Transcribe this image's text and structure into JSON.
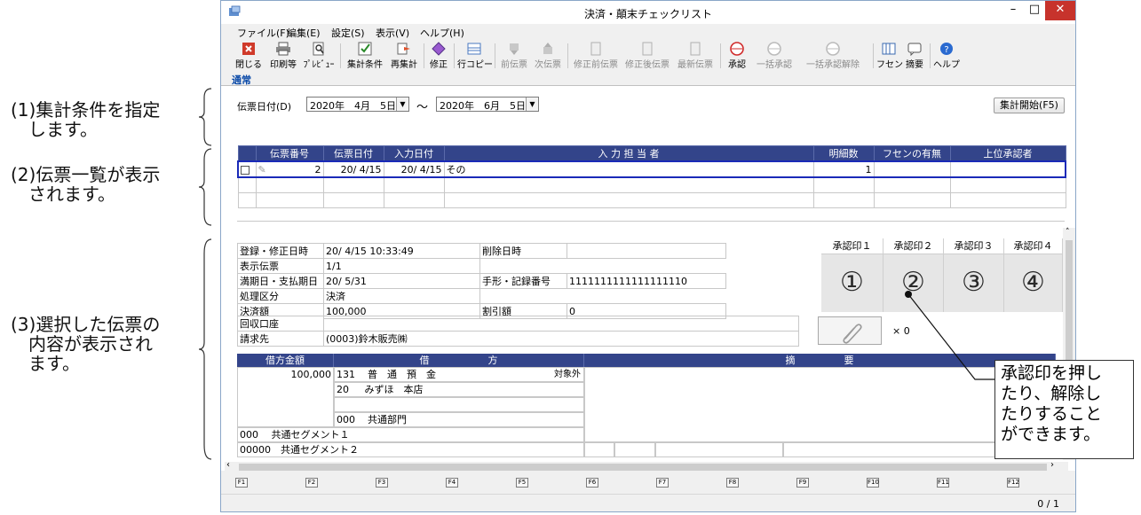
{
  "annotations": {
    "note1": "(1)集計条件を指定\n　します。",
    "note2": "(2)伝票一覧が表示\n　されます。",
    "note3": "(3)選択した伝票の\n　内容が表示され\n　ます。",
    "callout": "承認印を押し\nたり、解除し\nたりすること\nができます。"
  },
  "window": {
    "title": "決済・顛末チェックリスト",
    "minimize": "–",
    "maximize": "□",
    "close": "✕"
  },
  "menu": [
    "ファイル(F)",
    "編集(E)",
    "設定(S)",
    "表示(V)",
    "ヘルプ(H)"
  ],
  "toolbar": {
    "close": "閉じる",
    "print": "印刷等",
    "preview": "ﾌﾟﾚﾋﾞｭｰ",
    "conditions": "集計条件",
    "recalc": "再集計",
    "edit": "修正",
    "rowcopy": "行コピー",
    "prev": "前伝票",
    "next": "次伝票",
    "before_edit": "修正前伝票",
    "after_edit": "修正後伝票",
    "latest": "最新伝票",
    "approve": "承認",
    "bulk_approve": "一括承認",
    "bulk_release": "一括承認解除",
    "fusen": "フセン",
    "summary": "摘要",
    "help": "ヘルプ"
  },
  "tab": "通常",
  "filter": {
    "label": "伝票日付(D)",
    "from": "2020年　4月　5日",
    "tilde": "～",
    "to": "2020年　6月　5日",
    "start_button": "集計開始(F5)"
  },
  "list": {
    "headers": [
      "伝票番号",
      "伝票日付",
      "入力日付",
      "入 力 担 当 者",
      "明細数",
      "フセンの有無",
      "上位承認者"
    ],
    "rows": [
      {
        "no": "2",
        "date": "20/ 4/15",
        "input_date": "20/ 4/15",
        "staff": "その",
        "count": "1",
        "fusen": "",
        "approver": ""
      }
    ]
  },
  "detail": {
    "reg_label": "登録・修正日時",
    "reg_value": "20/ 4/15 10:33:49",
    "del_label": "削除日時",
    "del_value": "",
    "disp_label": "表示伝票",
    "disp_value": "1/1",
    "due_label": "満期日・支払期日",
    "due_value": "20/ 5/31",
    "bill_label": "手形・記録番号",
    "bill_value": "1111111111111111110",
    "kind_label": "処理区分",
    "kind_value": "決済",
    "amount_label": "決済額",
    "amount_value": "100,000",
    "discount_label": "割引額",
    "discount_value": "0",
    "account_label": "回収口座",
    "account_value": "",
    "billing_label": "請求先",
    "billing_value": "(0003)鈴木販売㈱"
  },
  "stamps": {
    "headers": [
      "承認印１",
      "承認印２",
      "承認印３",
      "承認印４"
    ],
    "marks": [
      "①",
      "②",
      "③",
      "④"
    ],
    "attach_count": "× 0"
  },
  "journal": {
    "h_amount": "借方金額",
    "h_debit": "借　　　　　　方",
    "h_memo": "摘　　　　　要",
    "amount": "100,000",
    "acct_code": "131",
    "acct_name": "普　通　預　金",
    "tax": "対象外",
    "bank_code": "20",
    "bank_name": "みずほ　本店",
    "dept_code": "000",
    "dept_name": "共通部門",
    "seg1": "000　 共通セグメント１",
    "seg2": "00000　共通セグメント２"
  },
  "fkeys": [
    "F1",
    "F2",
    "F3",
    "F4",
    "F5",
    "F6",
    "F7",
    "F8",
    "F9",
    "F10",
    "F11",
    "F12"
  ],
  "status": {
    "page": "0 / 1"
  },
  "colors": {
    "header_bg": "#33448a",
    "select_border": "#1a2ab8",
    "close_red": "#c7332c"
  }
}
